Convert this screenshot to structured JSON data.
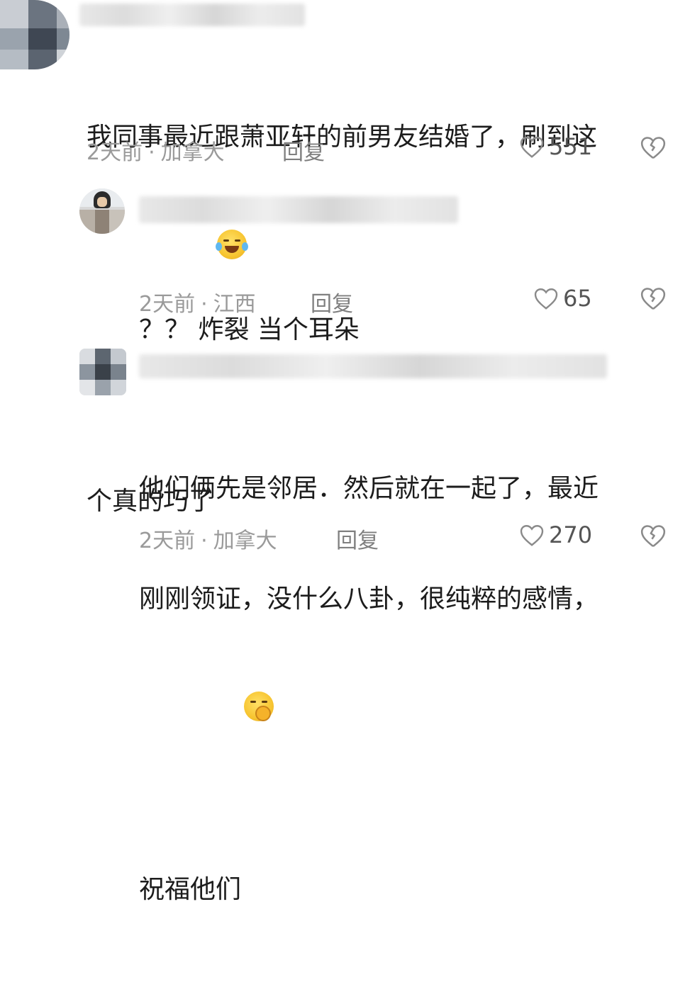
{
  "comments": [
    {
      "text_line1": "我同事最近跟萧亚轩的前男友结婚了，刷到这",
      "text_line2": "个真的巧了",
      "emoji": "crying-laughing-emoji",
      "time": "2天前",
      "location": "加拿大",
      "reply_label": "回复",
      "likes": "551"
    },
    {
      "text_line1": "？？ 炸裂 当个耳朵",
      "time": "2天前",
      "location": "江西",
      "reply_label": "回复",
      "likes": "65"
    },
    {
      "text_line1": "他们俩先是邻居．然后就在一起了，最近",
      "text_line2": "刚刚领证，没什么八卦，很纯粹的感情，",
      "text_line3": "祝福他们",
      "emoji": "shy-smile-emoji",
      "time": "2天前",
      "location": "加拿大",
      "reply_label": "回复",
      "likes": "270"
    }
  ],
  "separator": "·",
  "icons": {
    "like": "heart-outline-icon",
    "dislike": "broken-heart-icon"
  },
  "colors": {
    "meta_text": "#9a9a9a",
    "body_text": "#1c1c1c",
    "icon_gray": "#8a8a8a"
  }
}
